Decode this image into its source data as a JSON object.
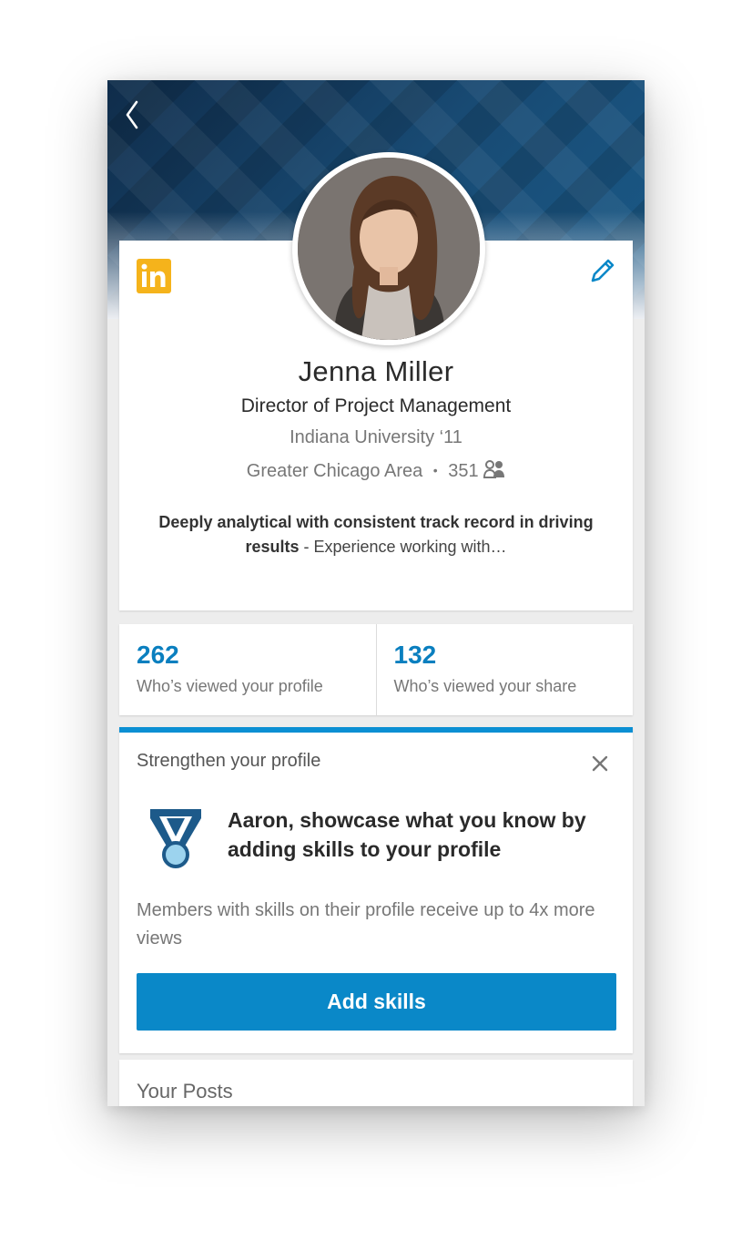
{
  "header": {
    "back_icon": "chevron-left-icon",
    "brand_logo": "in",
    "edit_icon": "pencil-icon"
  },
  "profile": {
    "name": "Jenna Miller",
    "headline": "Director of Project Management",
    "school": "Indiana University ‘11",
    "location": "Greater Chicago Area",
    "separator": "•",
    "connections": "351",
    "summary_bold": "Deeply analytical with consistent track record in driving results",
    "summary_rest": " - Experience working with…"
  },
  "stats": [
    {
      "value": "262",
      "label": "Who’s viewed your profile"
    },
    {
      "value": "132",
      "label": "Who’s viewed your share"
    }
  ],
  "strengthen": {
    "title": "Strengthen your profile",
    "prompt": "Aaron, showcase what you know by adding skills to your profile",
    "description": "Members with skills on their profile receive up to 4x more views",
    "button_label": "Add skills",
    "icon": "medal-icon"
  },
  "posts": {
    "title": "Your Posts"
  },
  "colors": {
    "accent": "#0a88c8",
    "stat_number": "#0a7fbf",
    "brand_logo_bg": "#f5b31b"
  }
}
